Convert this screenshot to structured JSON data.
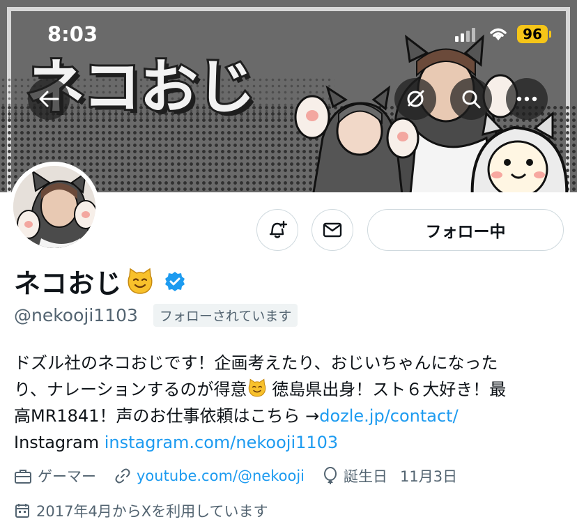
{
  "status_bar": {
    "time": "8:03",
    "battery": "96"
  },
  "banner": {
    "title": "ネコおじ"
  },
  "actions": {
    "follow_label": "フォロー中"
  },
  "profile": {
    "name": "ネコおじ",
    "handle": "@nekooji1103",
    "follows_you": "フォローされています"
  },
  "bio": {
    "line1": "ドズル社のネコおじです！企画考えたり、おじいちゃんになった",
    "line2a": "り、ナレーションするのが得意",
    "line2b": " 徳島県出身！スト６大好き！最",
    "line3a": "高MR1841！声のお仕事依頼はこちら →",
    "line3_link": "dozle.jp/contact/",
    "line4a": "Instagram ",
    "line4_link": "instagram.com/nekooji1103"
  },
  "meta": {
    "category": "ゲーマー",
    "website": "youtube.com/@nekooji",
    "birthday_label": "誕生日",
    "birthday": "11月3日",
    "joined": "2017年4月からXを利用しています"
  },
  "colors": {
    "link": "#1d9bf0",
    "secondary": "#536471",
    "verified": "#1d9bf0",
    "battery": "#f5c518"
  },
  "icons": [
    "back-arrow-icon",
    "grok-icon",
    "search-icon",
    "more-icon",
    "notification-bell-icon",
    "mail-icon",
    "verified-badge-icon",
    "cat-emoji-icon",
    "briefcase-icon",
    "link-icon",
    "balloon-icon",
    "calendar-icon",
    "signal-icon",
    "wifi-icon",
    "battery-icon"
  ]
}
